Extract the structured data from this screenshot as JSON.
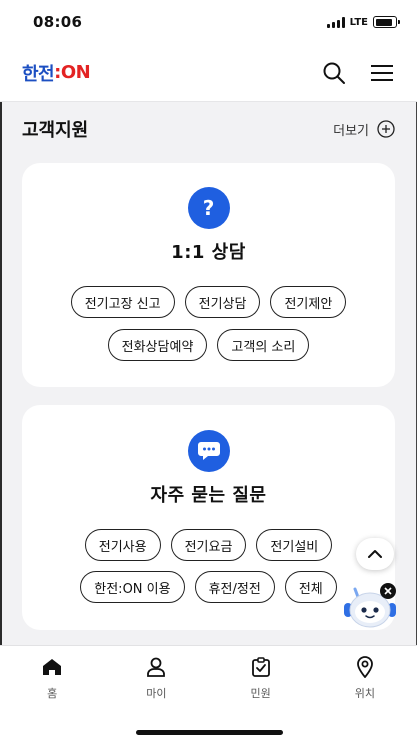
{
  "status_bar": {
    "time": "08:06",
    "network": "LTE",
    "battery_level": 0.85
  },
  "header": {
    "logo": {
      "main": "한전",
      "sep": ":",
      "accent": "ON"
    },
    "search_icon": "search-icon",
    "menu_icon": "hamburger-menu-icon",
    "brand_color": "#1c4fc2",
    "accent_color": "#e32323"
  },
  "section": {
    "title": "고객지원",
    "more_label": "더보기"
  },
  "support_card": {
    "icon": "question-icon",
    "title": "1:1 상담",
    "chips_row1": [
      "전기고장 신고",
      "전기상담",
      "전기제안"
    ],
    "chips_row2": [
      "전화상담예약",
      "고객의 소리"
    ]
  },
  "faq_card": {
    "icon": "chat-bubble-icon",
    "title": "자주 묻는 질문",
    "chips_row1": [
      "전기사용",
      "전기요금",
      "전기설비"
    ],
    "chips_row2": [
      "한전:ON 이용",
      "휴전/정전",
      "전체"
    ]
  },
  "floating": {
    "scroll_top_icon": "chevron-up-icon",
    "chatbot_icon": "chatbot-robot-icon",
    "close_icon": "close-icon"
  },
  "bottom_nav": {
    "items": [
      {
        "label": "홈",
        "icon": "home-icon"
      },
      {
        "label": "마이",
        "icon": "person-icon"
      },
      {
        "label": "민원",
        "icon": "clipboard-check-icon"
      },
      {
        "label": "위치",
        "icon": "location-pin-icon"
      }
    ]
  },
  "accent_blue": "#1f5fe0"
}
